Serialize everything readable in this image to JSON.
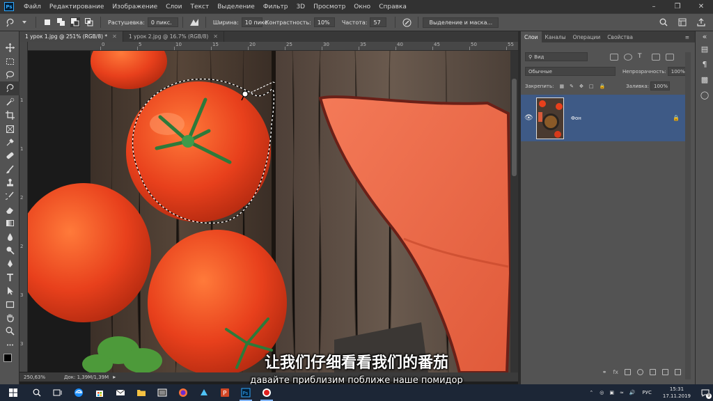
{
  "app": {
    "logo": "Ps"
  },
  "menu": [
    "Файл",
    "Редактирование",
    "Изображение",
    "Слои",
    "Текст",
    "Выделение",
    "Фильтр",
    "3D",
    "Просмотр",
    "Окно",
    "Справка"
  ],
  "options": {
    "feather_label": "Растушевка:",
    "feather_value": "0 пикс.",
    "width_label": "Ширина:",
    "width_value": "10 пикс",
    "contrast_label": "Контрастность:",
    "contrast_value": "10%",
    "frequency_label": "Частота:",
    "frequency_value": "57",
    "select_mask_label": "Выделение и маска..."
  },
  "tabs": [
    {
      "label": "1 урок 1.jpg @ 251% (RGB/8) *",
      "active": true
    },
    {
      "label": "1 урок 2.jpg @ 16.7% (RGB/8)",
      "active": false
    }
  ],
  "ruler": {
    "top_ticks": [
      "0",
      "5",
      "10",
      "15",
      "20",
      "25",
      "30",
      "35",
      "40",
      "45",
      "50",
      "55"
    ]
  },
  "status": {
    "zoom": "250,63%",
    "doc": "Док: 1,39M/1,39M"
  },
  "layers_panel": {
    "tabs": [
      "Слои",
      "Каналы",
      "Операции",
      "Свойства"
    ],
    "filter_value": "Вид",
    "blend_mode": "Обычные",
    "opacity_label": "Непрозрачность:",
    "opacity_value": "100%",
    "lock_label": "Закрепить:",
    "fill_label": "Заливка:",
    "fill_value": "100%",
    "layer_name": "Фон"
  },
  "subtitles": {
    "cn": "让我们仔细看看我们的番茄",
    "ru": "давайте приблизим поближе наше помидор"
  },
  "taskbar": {
    "lang": "РУС",
    "time": "15:31",
    "date": "17.11.2019",
    "notification_count": "9"
  },
  "colors": {
    "accent": "#31a8ff",
    "layer_selected": "#3e5a86",
    "tomato": "#e8401c",
    "napkin": "#ef6a4a",
    "wood": "#4a3a2e"
  }
}
